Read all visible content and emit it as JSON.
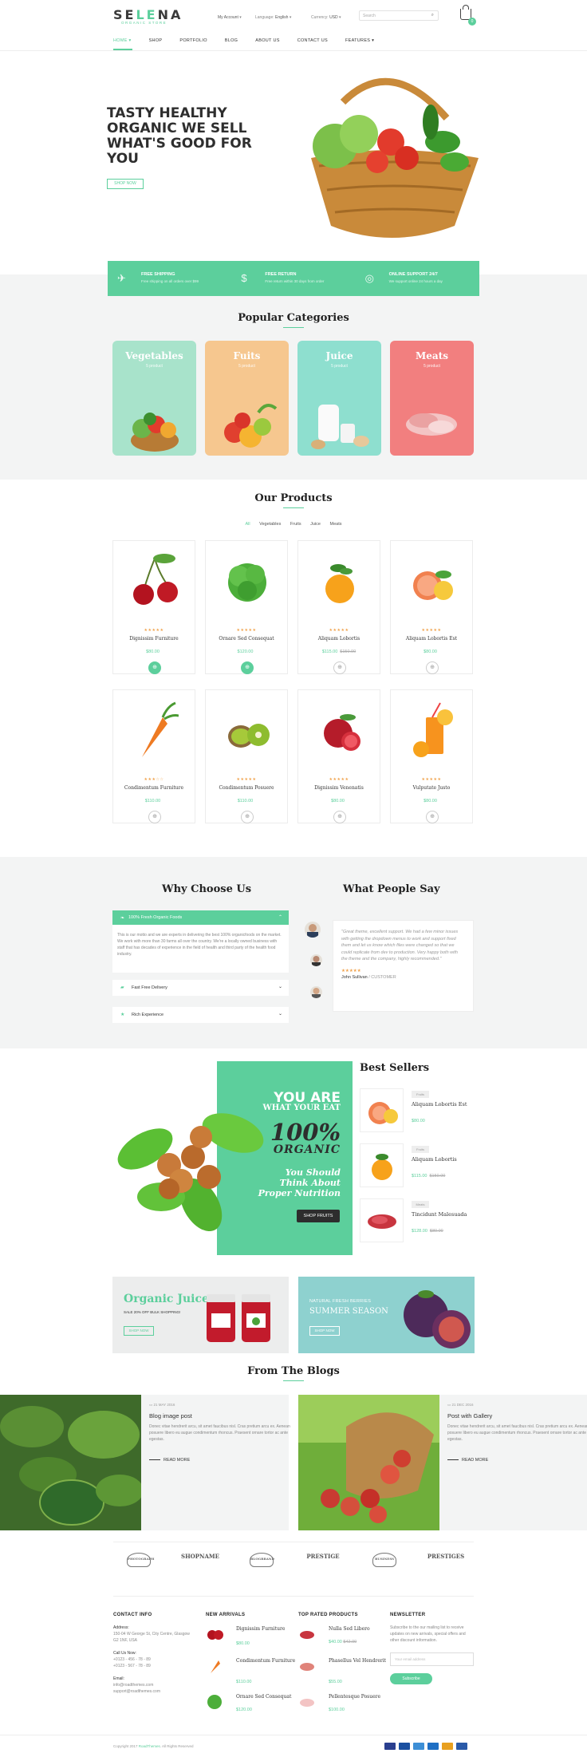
{
  "header": {
    "logo_left": "SE",
    "logo_mid": "LE",
    "logo_right": "NA",
    "logo_sub": "ORGANIC STORE",
    "account": "My Account",
    "language_label": "Language:",
    "language_value": "English",
    "currency_label": "Currency:",
    "currency_value": "USD",
    "search_placeholder": "Search",
    "cart_count": "0"
  },
  "nav": [
    "HOME",
    "SHOP",
    "PORTFOLIO",
    "BLOG",
    "ABOUT US",
    "CONTACT US",
    "FEATURES"
  ],
  "hero": {
    "title": "TASTY HEALTHY ORGANIC WE SELL WHAT'S GOOD FOR YOU",
    "button": "SHOP NOW"
  },
  "features": [
    {
      "title": "FREE SHIPPING",
      "sub": "Free shipping on all orders over $99",
      "icon": "paper-plane-icon"
    },
    {
      "title": "FREE RETURN",
      "sub": "Free return within 30 days from order",
      "icon": "dollar-icon"
    },
    {
      "title": "ONLINE SUPPORT 24/7",
      "sub": "We support online 24 hours a day",
      "icon": "support-icon"
    }
  ],
  "categories": {
    "title": "Popular Categories",
    "items": [
      {
        "name": "Vegetables",
        "count": "5 product",
        "color": "#a8e3cb"
      },
      {
        "name": "Fuits",
        "count": "5 product",
        "color": "#f6c78f"
      },
      {
        "name": "Juice",
        "count": "5 product",
        "color": "#8edfcf"
      },
      {
        "name": "Meats",
        "count": "5 product",
        "color": "#f27f7f"
      }
    ]
  },
  "products": {
    "title": "Our Products",
    "tabs": [
      "All",
      "Vegetables",
      "Fruits",
      "Juice",
      "Meats"
    ],
    "items": [
      {
        "name": "Dignissim Furniture",
        "price": "$80.00",
        "old": "",
        "stars": "★★★★★"
      },
      {
        "name": "Ornare Sed Consequat",
        "price": "$120.00",
        "old": "",
        "stars": "★★★★★"
      },
      {
        "name": "Aliquam Lobortis",
        "price": "$115.00",
        "old": "$150.00",
        "stars": "★★★★★"
      },
      {
        "name": "Aliquam Lobortis Est",
        "price": "$80.00",
        "old": "",
        "stars": "★★★★★"
      },
      {
        "name": "Condimentum Furniture",
        "price": "$110.00",
        "old": "",
        "stars": "★★★☆☆"
      },
      {
        "name": "Condimentum Posuere",
        "price": "$110.00",
        "old": "",
        "stars": "★★★★★"
      },
      {
        "name": "Dignissim Venenatis",
        "price": "$80.00",
        "old": "",
        "stars": "★★★★★"
      },
      {
        "name": "Vulputate Justo",
        "price": "$80.00",
        "old": "",
        "stars": "★★★★★"
      }
    ]
  },
  "why": {
    "title": "Why Choose Us",
    "open_title": "100% Fresh Organic Foods",
    "open_body": "This is our motto and we are experts in delivering the best 100% organicfoods on the market. We work with more than 30 farms all over the country. We're a locally owned business with staff that has decades of experience in the field of health and third party of the health food industry.",
    "item2": "Fast Free Delivery",
    "item3": "Rich Experience"
  },
  "testimonial": {
    "title": "What People Say",
    "quote": "\"Great theme, excellent support. We had a few minor issues with getting the dropdown menus to work and support fixed them and let us know which files were changed so that we could replicate from dev to production. Very happy both with the theme and the company, highly recommended.\"",
    "stars": "★★★★★",
    "author": "John Sullivan",
    "role": "/ CUSTOMER"
  },
  "promo": {
    "line1": "YOU ARE",
    "line2": "WHAT YOUR EAT",
    "line3": "100%",
    "line4": "ORGANIC",
    "line5": "You Should Think About Proper Nutrition",
    "button": "SHOP FRUITS"
  },
  "bestsellers": {
    "title": "Best Sellers",
    "items": [
      {
        "tag": "Fruits",
        "name": "Aliquam Lobortis Est",
        "price": "$80.00",
        "old": ""
      },
      {
        "tag": "Fruits",
        "name": "Aliquam Lobortis",
        "price": "$115.00",
        "old": "$150.00"
      },
      {
        "tag": "Meats",
        "name": "Tincidunt Malesuada",
        "price": "$128.00",
        "old": "$80.00"
      }
    ]
  },
  "banners": {
    "left_title": "Organic Juice",
    "left_sub": "SALE 20% OFF BULK SHOPPING!",
    "left_btn": "SHOP NOW",
    "right_title1": "NATURAL FRESH BERRIES",
    "right_title2": "SUMMER SEASON",
    "right_btn": "SHOP NOW"
  },
  "blogs": {
    "title": "From The Blogs",
    "items": [
      {
        "date": "21 MAY 2016",
        "title": "Blog image post",
        "text": "Donec vitae hendrerit arcu, sit amet faucibus nisl. Cras pretium arcu ex. Aenean posuere libero eu augue condimentum rhoncus. Praesent ornare tortor ac ante egestas.",
        "more": "READ MORE"
      },
      {
        "date": "21 DEC 2016",
        "title": "Post with Gallery",
        "text": "Donec vitae hendrerit arcu, sit amet faucibus nisl. Cras pretium arcu ex. Aenean posuere libero eu augue condimentum rhoncus. Praesent ornare tortor ac ante egestas.",
        "more": "READ MORE"
      }
    ]
  },
  "brands": [
    "PHOTOGRAPH",
    "SHOPNAME",
    "BLOGBRAND",
    "PRESTIGE",
    "BUSINESS",
    "PRESTIGES"
  ],
  "footer": {
    "contact_title": "CONTACT INFO",
    "address_label": "Address:",
    "address": "150-04 W George St, City Centre, Glasgow G2 1NF, USA",
    "call_label": "Call Us Now:",
    "phone1": "+0123 - 456 - 78 - 89",
    "phone2": "+0123 - 567 - 78 - 89",
    "email_label": "Email:",
    "email1": "info@roadthemes.com",
    "email2": "support@roadthemes.com",
    "new_title": "NEW ARRIVALS",
    "new_items": [
      {
        "name": "Dignissim Furniture",
        "price": "$80.00"
      },
      {
        "name": "Condimentum Furniture",
        "price": "$110.00"
      },
      {
        "name": "Ornare Sed Consequat",
        "price": "$120.00"
      }
    ],
    "top_title": "TOP RATED PRODUCTS",
    "top_items": [
      {
        "name": "Nulla Sed Libero",
        "price": "$40.00",
        "old": "$42.00"
      },
      {
        "name": "Phasellus Vel Hendrerit",
        "price": "$55.00",
        "old": ""
      },
      {
        "name": "Pellentesque Posuere",
        "price": "$100.00",
        "old": ""
      }
    ],
    "nl_title": "NEWSLETTER",
    "nl_text": "Subscribe to the our mailing list to receive updates on new arrivals, special offers and other discount information.",
    "nl_placeholder": "Your email address",
    "nl_button": "Subscribe",
    "copyright_pre": "Copyright 2017 ",
    "copyright_brand": "RoadThemes",
    "copyright_post": ". All Rights Reserved"
  }
}
